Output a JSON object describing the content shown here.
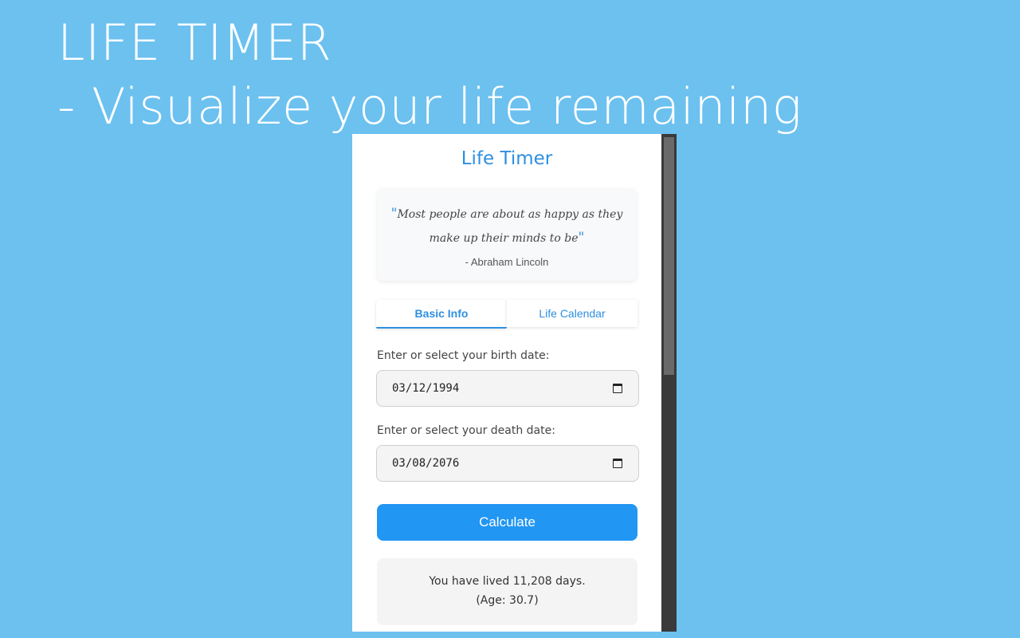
{
  "banner": {
    "line1": "LIFE TIMER",
    "line2": "- Visualize your life remaining"
  },
  "popup": {
    "title": "Life Timer",
    "quote": {
      "open_mark": "\"",
      "text": "Most people are about as happy as they make up their minds to be",
      "close_mark": "\"",
      "author": "- Abraham Lincoln"
    },
    "tabs": [
      {
        "label": "Basic Info",
        "active": true
      },
      {
        "label": "Life Calendar",
        "active": false
      }
    ],
    "birth": {
      "label": "Enter or select your birth date:",
      "value": "03/12/1994",
      "icon": "calendar-icon"
    },
    "death": {
      "label": "Enter or select your death date:",
      "value": "03/08/2076",
      "icon": "calendar-icon"
    },
    "calculate_label": "Calculate",
    "result": {
      "lived": "You have lived 11,208 days.",
      "age": "(Age: 30.7)"
    }
  },
  "colors": {
    "background": "#6cc1ef",
    "accent": "#2f8fe0",
    "button": "#2196f3"
  }
}
